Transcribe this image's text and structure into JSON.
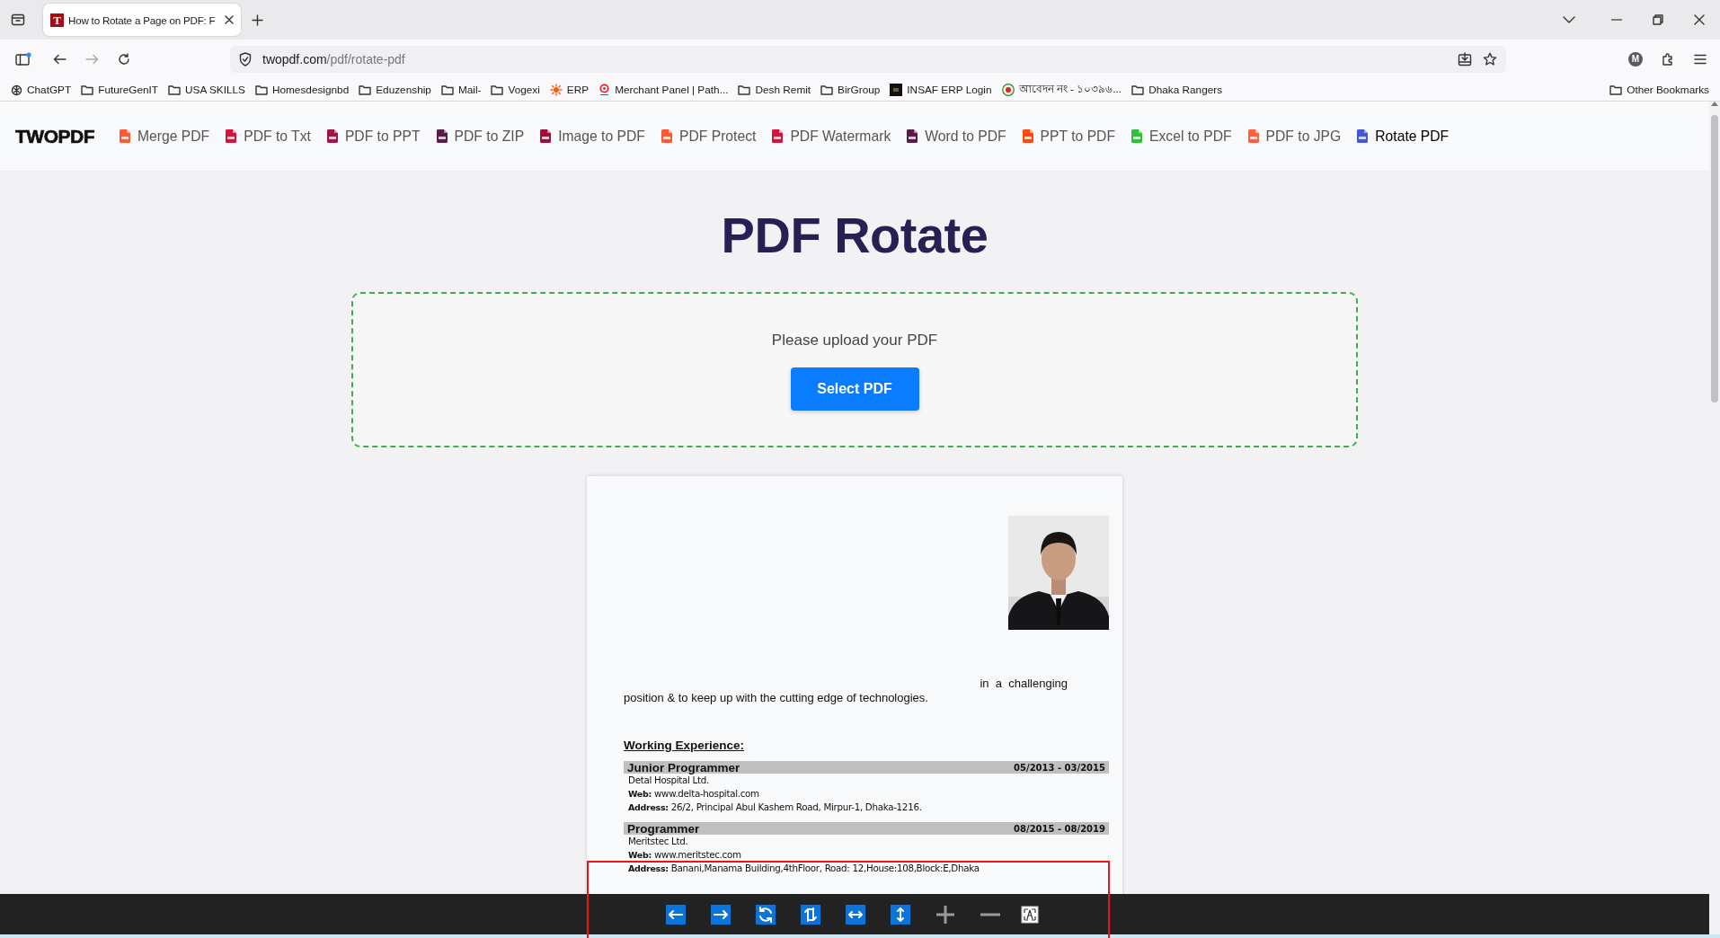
{
  "browser": {
    "tabs": [
      {
        "title": "How to Rotate a Page on PDF: F",
        "favicon": "T",
        "selected": true
      }
    ],
    "address": {
      "domain": "twopdf.com",
      "path": "/pdf/rotate-pdf"
    },
    "profile": "M",
    "bookmarks": [
      {
        "label": "ChatGPT",
        "kind": "chatgpt"
      },
      {
        "label": "FutureGenIT",
        "kind": "folder"
      },
      {
        "label": "USA SKILLS",
        "kind": "folder"
      },
      {
        "label": "Homesdesignbd",
        "kind": "folder"
      },
      {
        "label": "Eduzenship",
        "kind": "folder"
      },
      {
        "label": "Mail-",
        "kind": "folder"
      },
      {
        "label": "Vogexi",
        "kind": "folder"
      },
      {
        "label": "ERP",
        "kind": "sun"
      },
      {
        "label": "Merchant Panel | Path...",
        "kind": "merchant"
      },
      {
        "label": "Desh Remit",
        "kind": "folder"
      },
      {
        "label": "BirGroup",
        "kind": "folder"
      },
      {
        "label": "INSAF ERP Login",
        "kind": "square"
      },
      {
        "label": "আবেদন নং - ১০৩৯৬...",
        "kind": "emblem"
      },
      {
        "label": "Dhaka Rangers",
        "kind": "folder"
      }
    ],
    "other_bookmarks": "Other Bookmarks"
  },
  "nav": {
    "logo": "TWOPDF",
    "items": [
      {
        "label": "Merge PDF",
        "color": "#ff5a36",
        "selected": false
      },
      {
        "label": "PDF to Txt",
        "color": "#d4143c",
        "selected": false
      },
      {
        "label": "PDF to PPT",
        "color": "#a2134a",
        "selected": false
      },
      {
        "label": "PDF to ZIP",
        "color": "#5a1a4a",
        "selected": false
      },
      {
        "label": "Image to PDF",
        "color": "#9b0f3b",
        "selected": false
      },
      {
        "label": "PDF Protect",
        "color": "#ff5a36",
        "selected": false
      },
      {
        "label": "PDF Watermark",
        "color": "#d4143c",
        "selected": false
      },
      {
        "label": "Word to PDF",
        "color": "#5a1a4a",
        "selected": false
      },
      {
        "label": "PPT to PDF",
        "color": "#ff4a12",
        "selected": false
      },
      {
        "label": "Excel to PDF",
        "color": "#2ec23a",
        "selected": false
      },
      {
        "label": "PDF to JPG",
        "color": "#ff6040",
        "selected": false
      },
      {
        "label": "Rotate PDF",
        "color": "#4358d8",
        "selected": true
      }
    ]
  },
  "page_title": "PDF Rotate",
  "upload": {
    "prompt": "Please upload your PDF",
    "button": "Select PDF"
  },
  "document": {
    "objective_end": "in  a  challenging",
    "objective_line": "position & to keep up with the cutting edge of technologies.",
    "section_heading": "Working Experience:",
    "jobs": [
      {
        "title": "Junior Programmer",
        "dates": "05/2013 - 03/2015",
        "company": "Detal Hospital Ltd.",
        "web": "**Web:** www.delta-hospital.com",
        "address": "**Address:** 26/2, Principal Abul Kashem Road, Mirpur-1, Dhaka-1216."
      },
      {
        "title": "Programmer",
        "dates": "08/2015 - 08/2019",
        "company": "Meritstec Ltd.",
        "web": "**Web:** www.meritstec.com",
        "address": "**Address:** Banani,Manama Building,4thFloor, Road: 12,House:108,Block:E,Dhaka"
      }
    ]
  },
  "viewer_toolbar": {
    "buttons": [
      {
        "kind": "rotate-left"
      },
      {
        "kind": "rotate-right"
      },
      {
        "kind": "rotate"
      },
      {
        "kind": "flip"
      },
      {
        "kind": "flip-horizontal"
      },
      {
        "kind": "flip-vertical"
      },
      {
        "kind": "zoom-in"
      },
      {
        "kind": "zoom-out"
      },
      {
        "kind": "fit"
      }
    ]
  }
}
